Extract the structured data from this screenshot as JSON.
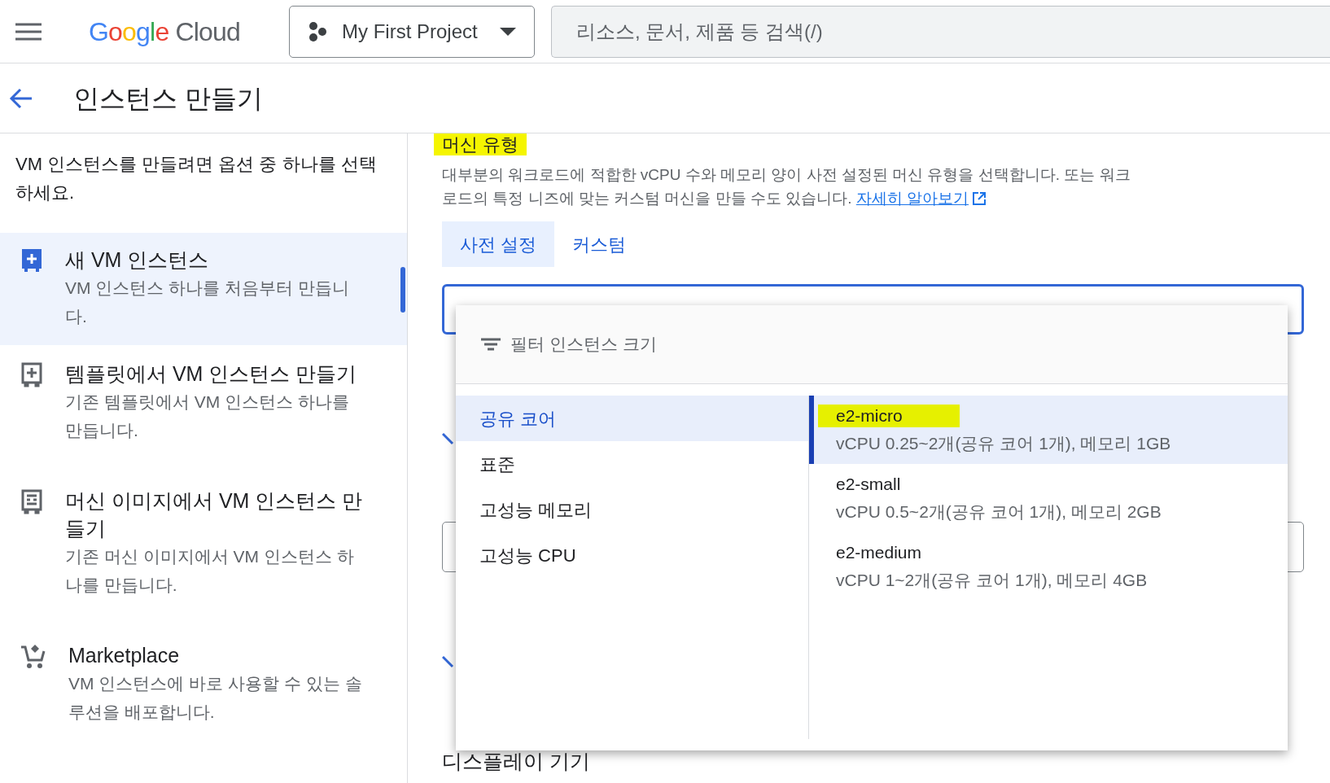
{
  "header": {
    "logo_google": "Google",
    "logo_cloud": "Cloud",
    "project": "My First Project",
    "search": {
      "placeholder": "리소스, 문서, 제품 등 검색(/)"
    }
  },
  "page_title": "인스턴스 만들기",
  "sidebar": {
    "intro": "VM 인스턴스를 만들려면 옵션 중 하나를 선택하세요.",
    "items": [
      {
        "kind": "new",
        "title": "새 VM 인스턴스",
        "description": "VM 인스턴스 하나를 처음부터 만듭니다.",
        "selected": true
      },
      {
        "kind": "template",
        "title": "템플릿에서 VM 인스턴스 만들기",
        "description": "기존 템플릿에서 VM 인스턴스 하나를 만듭니다.",
        "selected": false
      },
      {
        "kind": "image",
        "title": "머신 이미지에서 VM 인스턴스 만들기",
        "description": "기존 머신 이미지에서 VM 인스턴스 하나를 만듭니다.",
        "selected": false
      },
      {
        "kind": "marketplace",
        "title": "Marketplace",
        "description": "VM 인스턴스에 바로 사용할 수 있는 솔루션을 배포합니다.",
        "selected": false
      }
    ]
  },
  "section": {
    "title": "머신 유형",
    "highlighted": true,
    "description": "대부분의 워크로드에 적합한 vCPU 수와 메모리 양이 사전 설정된 머신 유형을 선택합니다. 또는 워크로드의 특정 니즈에 맞는 커스텀 머신을 만들 수도 있습니다.",
    "link": "자세히 알아보기",
    "tabs": [
      {
        "label": "사전 설정",
        "selected": true
      },
      {
        "label": "커스텀",
        "selected": false
      }
    ]
  },
  "dropdown": {
    "filter": {
      "placeholder": "필터 인스턴스 크기"
    },
    "families": [
      {
        "label": "공유 코어",
        "selected": true
      },
      {
        "label": "표준",
        "selected": false
      },
      {
        "label": "고성능 메모리",
        "selected": false
      },
      {
        "label": "고성능 CPU",
        "selected": false
      }
    ],
    "types": [
      {
        "name": "e2-micro",
        "spec": "vCPU 0.25~2개(공유 코어 1개), 메모리 1GB",
        "selected": true,
        "highlighted": true
      },
      {
        "name": "e2-small",
        "spec": "vCPU 0.5~2개(공유 코어 1개), 메모리 2GB",
        "selected": false,
        "highlighted": false
      },
      {
        "name": "e2-medium",
        "spec": "vCPU 1~2개(공유 코어 1개), 메모리 4GB",
        "selected": false,
        "highlighted": false
      }
    ]
  },
  "next_section": "디스플레이 기기"
}
